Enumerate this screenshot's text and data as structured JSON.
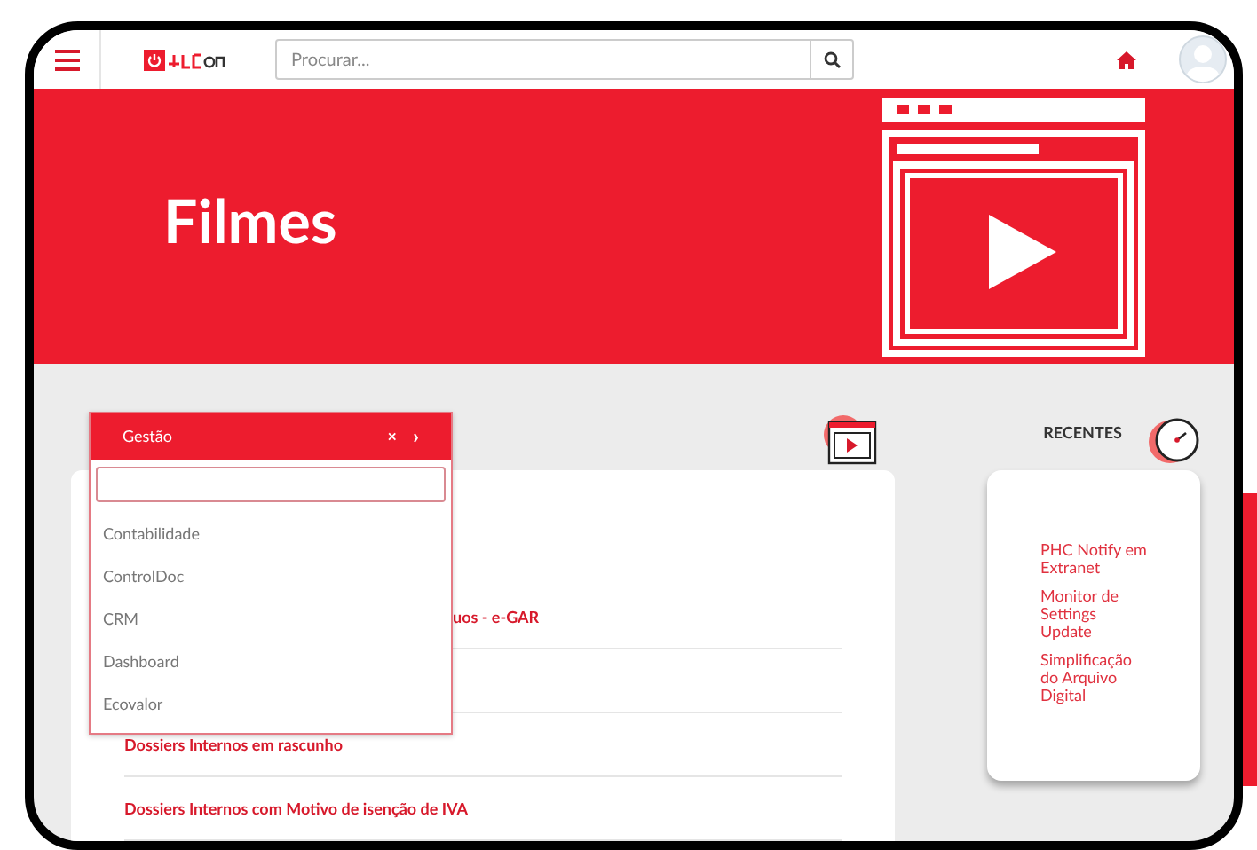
{
  "header": {
    "search": {
      "placeholder": "Procurar..."
    }
  },
  "banner": {
    "title": "Filmes"
  },
  "list": {
    "rows": [
      {
        "text": "uos - e-GAR",
        "partial": true
      },
      {
        "text": "Dossiers Internos em rascunho",
        "partial": false
      },
      {
        "text": "Dossiers Internos com Motivo de isenção de IVA",
        "partial": false
      }
    ]
  },
  "recent": {
    "title": "RECENTES",
    "items": [
      "PHC Notify em Extranet",
      "Monitor de Settings Update",
      "Simplificação do Arquivo Digital"
    ]
  },
  "dropdown": {
    "title": "Gestão",
    "close": "×",
    "next": "›",
    "items": [
      "Contabilidade",
      "ControlDoc",
      "CRM",
      "Dashboard",
      "Ecovalor"
    ]
  }
}
